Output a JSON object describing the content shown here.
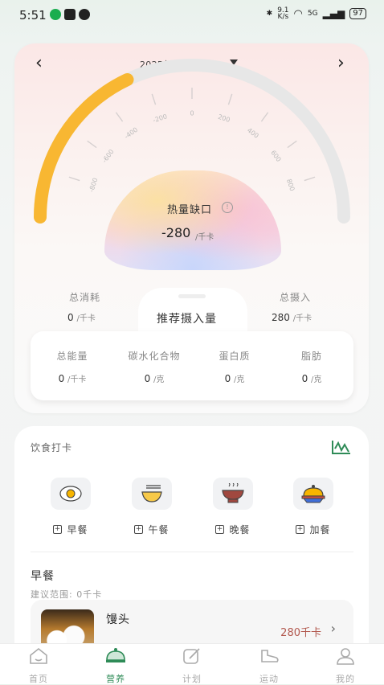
{
  "status_bar": {
    "time": "5:51",
    "net_speed_top": "9.1",
    "net_speed_unit": "K/s",
    "signal": "5G",
    "battery": "97"
  },
  "header": {
    "date": "2025年05月13日",
    "prev_icon": "chevron-left-icon",
    "next_icon": "chevron-right-icon"
  },
  "gauge": {
    "ticks": [
      "-800",
      "-600",
      "-400",
      "-200",
      "0",
      "200",
      "400",
      "600",
      "800"
    ],
    "min": -1000,
    "max": 1000,
    "value": -280,
    "fill_color": "#f8b732",
    "track_color": "#e7e7e7",
    "deficit_label": "热量缺口",
    "deficit_value": "-280",
    "deficit_unit": "/千卡"
  },
  "summary": {
    "consumed_label": "总消耗",
    "consumed_value": "0",
    "consumed_unit": "/千卡",
    "intake_label": "总摄入",
    "intake_value": "280",
    "intake_unit": "/千卡",
    "recommend_title": "推荐摄入量"
  },
  "nutrients": [
    {
      "label": "总能量",
      "value": "0",
      "unit": "/千卡"
    },
    {
      "label": "碳水化合物",
      "value": "0",
      "unit": "/克"
    },
    {
      "label": "蛋白质",
      "value": "0",
      "unit": "/克"
    },
    {
      "label": "脂肪",
      "value": "0",
      "unit": "/克"
    }
  ],
  "diet": {
    "title": "饮食打卡",
    "chart_icon": "trend-chart-icon",
    "meals": [
      {
        "label": "早餐",
        "icon": "fried-egg-icon"
      },
      {
        "label": "午餐",
        "icon": "noodle-bowl-icon"
      },
      {
        "label": "晚餐",
        "icon": "hotpot-icon"
      },
      {
        "label": "加餐",
        "icon": "food-cloche-icon"
      }
    ],
    "breakfast": {
      "title": "早餐",
      "range": "建议范围: 0千卡",
      "food_name": "馒头",
      "food_kcal": "280千卡"
    }
  },
  "tabbar": [
    {
      "label": "首页",
      "icon": "home-icon"
    },
    {
      "label": "营养",
      "icon": "nutrition-cloche-icon",
      "active": true
    },
    {
      "label": "计划",
      "icon": "edit-plan-icon"
    },
    {
      "label": "运动",
      "icon": "sneaker-icon"
    },
    {
      "label": "我的",
      "icon": "user-icon"
    }
  ]
}
